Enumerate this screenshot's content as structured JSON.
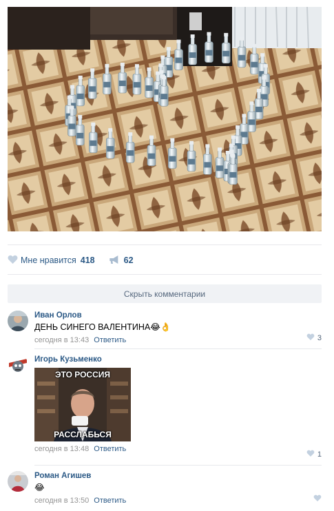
{
  "post": {
    "likes_label": "Мне нравится",
    "likes_count": "418",
    "shares_count": "62"
  },
  "comments_toggle": "Скрыть комментарии",
  "comments": [
    {
      "author": "Иван Орлов",
      "text": "ДЕНЬ СИНЕГО ВАЛЕНТИНА",
      "emoji": "😂👌",
      "time": "сегодня в 13:43",
      "reply": "Ответить",
      "likes": "3"
    },
    {
      "author": "Игорь Кузьменко",
      "meme_top": "ЭТО РОССИЯ",
      "meme_bottom": "РАССЛАБЬСЯ",
      "time": "сегодня в 13:48",
      "reply": "Ответить",
      "likes": "1"
    },
    {
      "author": "Роман Агишев",
      "emoji": "😂",
      "time": "сегодня в 13:50",
      "reply": "Ответить",
      "likes": ""
    }
  ],
  "colors": {
    "link": "#2a5885",
    "meta": "#939393",
    "divider": "#e7e8ec",
    "button_bg": "#f0f2f5"
  },
  "icons": [
    "heart-icon",
    "megaphone-icon"
  ]
}
